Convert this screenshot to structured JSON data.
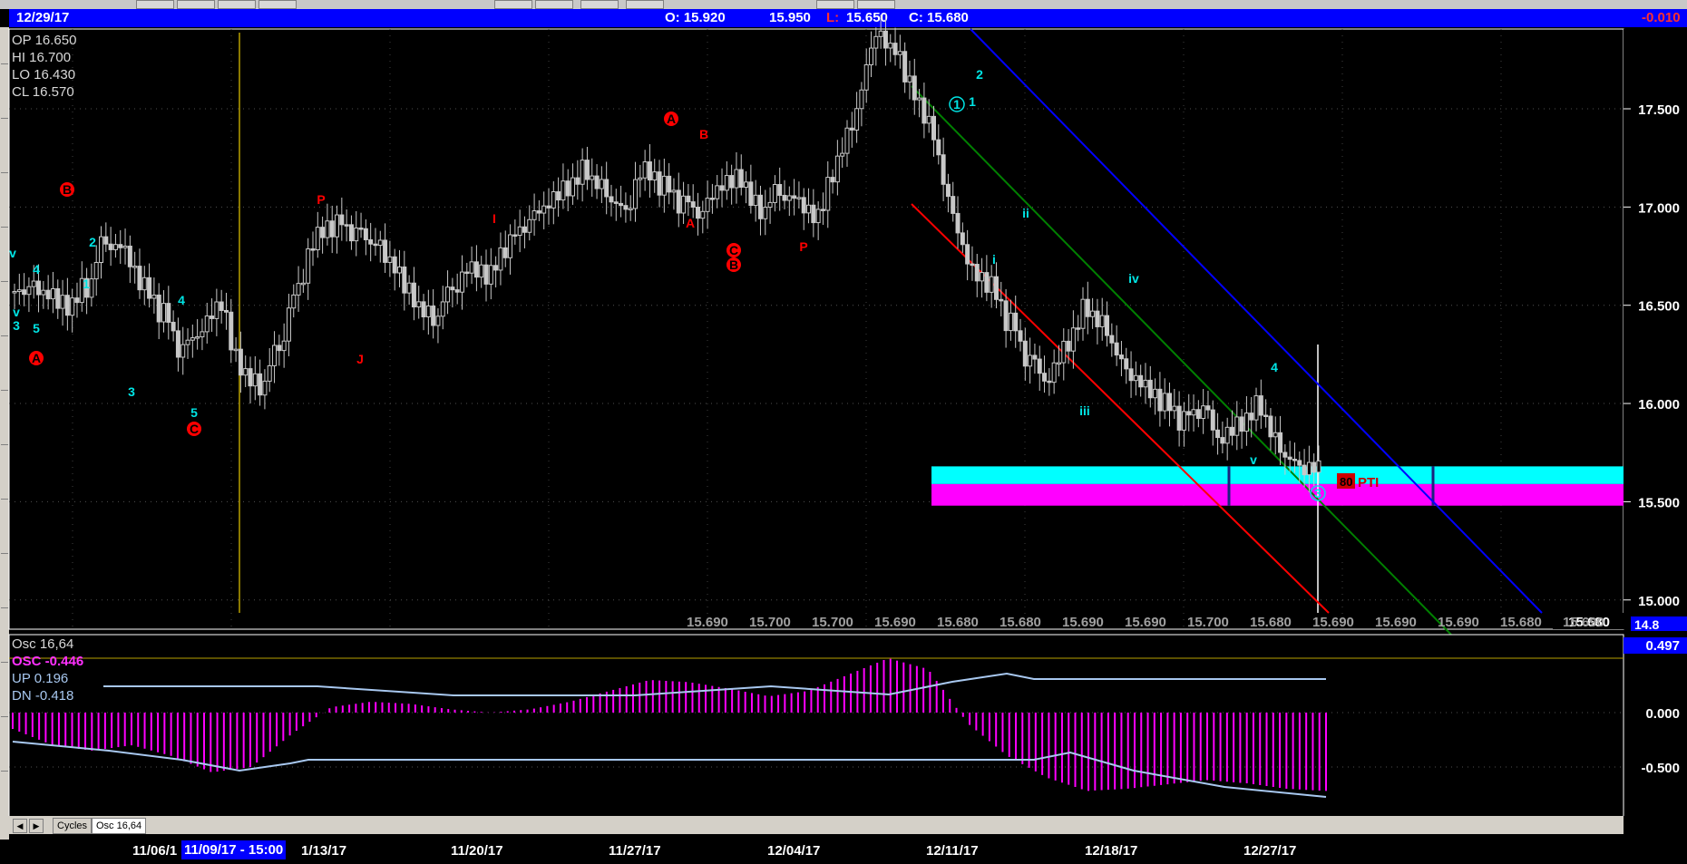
{
  "header": {
    "date": "12/29/17",
    "open": "O: 15.920",
    "high": "15.950",
    "low_label": "L:",
    "low_value": "15.650",
    "close": "C: 15.680",
    "change": "-0.010"
  },
  "ohlc_box": [
    "OP 16.650",
    "HI 16.700",
    "LO 16.430",
    "CL 16.570"
  ],
  "osc_legend": {
    "name": "Osc 16,64",
    "osc": "OSC -0.446",
    "up": "UP   0.196",
    "dn": "DN   -0.418"
  },
  "tabs": [
    "Cycles",
    "Osc 16,64"
  ],
  "tab_arrows": [
    "◀",
    "▶"
  ],
  "bottom_values": [
    "15.690",
    "15.700",
    "15.700",
    "15.690",
    "15.680",
    "15.680",
    "15.690",
    "15.690",
    "15.700",
    "15.680",
    "15.690",
    "15.690",
    "15.690",
    "15.680",
    "15.690"
  ],
  "last_price_label": "15.680",
  "price_axis_edge": "14.8",
  "osc_axis_top": "0.497",
  "pti_label": "PTI",
  "pti_value": "80",
  "dates": {
    "labels": [
      "11/06/1",
      "1/13/17",
      "11/20/17",
      "11/27/17",
      "12/04/17",
      "12/11/17",
      "12/18/17",
      "12/27/17"
    ],
    "highlight": "11/09/17 - 15:00"
  },
  "colors": {
    "background": "#000000",
    "info_bar": "#0000ff",
    "candle": "#c8c8c8",
    "wave_cyan": "#00e5e5",
    "wave_red": "#ff0000",
    "zone_cyan": "#00ffff",
    "zone_magenta": "#ff00ff",
    "channel_blue": "#0000ff",
    "channel_green": "#008000",
    "channel_red": "#ff0000",
    "osc_hist": "#ff00ff",
    "osc_bands": "#a8c8f0",
    "cursor_line": "#b8a000"
  },
  "chart_data": [
    {
      "type": "candlestick",
      "title": "",
      "x_axis": [
        "11/06/1",
        "11/09/17 - 15:00",
        "1/13/17",
        "11/20/17",
        "11/27/17",
        "12/04/17",
        "12/11/17",
        "12/18/17",
        "12/27/17"
      ],
      "y_ticks": [
        "17.500",
        "17.000",
        "16.500",
        "16.000",
        "15.500",
        "15.000"
      ],
      "ylim": [
        14.8,
        17.9
      ],
      "closes": [
        16.57,
        16.55,
        16.5,
        16.6,
        16.85,
        16.8,
        16.6,
        16.45,
        16.25,
        16.35,
        16.5,
        16.2,
        16.1,
        16.3,
        16.6,
        16.85,
        16.9,
        16.85,
        16.8,
        16.7,
        16.55,
        16.45,
        16.6,
        16.7,
        16.65,
        16.8,
        16.9,
        17.0,
        17.1,
        17.2,
        17.1,
        17.0,
        17.2,
        17.1,
        17.0,
        16.95,
        17.1,
        17.15,
        17.0,
        17.1,
        17.05,
        16.95,
        17.2,
        17.45,
        17.85,
        17.8,
        17.6,
        17.4,
        17.0,
        16.7,
        16.6,
        16.4,
        16.2,
        16.1,
        16.3,
        16.5,
        16.4,
        16.2,
        16.1,
        16.0,
        15.9,
        15.95,
        15.8,
        15.9,
        16.0,
        15.8,
        15.7,
        15.68
      ],
      "wave_labels_cyan": [
        "v",
        "4",
        "v",
        "3",
        "5",
        "2",
        "1",
        "3",
        "4",
        "5",
        "1",
        "2",
        "1",
        "i",
        "ii",
        "iii",
        "iv",
        "v",
        "4",
        "3"
      ],
      "wave_labels_red": [
        "A",
        "B",
        "C",
        "P",
        "J",
        "I",
        "A",
        "B",
        "A",
        "C",
        "B",
        "P"
      ],
      "zone": {
        "cyan_from": 15.59,
        "cyan_to": 15.68,
        "magenta_from": 15.48,
        "magenta_to": 15.59
      }
    },
    {
      "type": "bar",
      "title": "",
      "y_ticks": [
        "0.000",
        "-0.500"
      ],
      "ylim": [
        -0.85,
        0.55
      ],
      "values": [
        -0.15,
        -0.3,
        -0.35,
        -0.3,
        -0.4,
        -0.55,
        -0.5,
        -0.2,
        0.05,
        0.1,
        0.08,
        0.03,
        0.0,
        0.03,
        0.1,
        0.2,
        0.3,
        0.28,
        0.22,
        0.15,
        0.2,
        0.35,
        0.5,
        0.4,
        -0.1,
        -0.4,
        -0.6,
        -0.72,
        -0.7,
        -0.66,
        -0.62,
        -0.65,
        -0.7,
        -0.72
      ],
      "up_band": 0.196,
      "dn_band": -0.418
    }
  ]
}
